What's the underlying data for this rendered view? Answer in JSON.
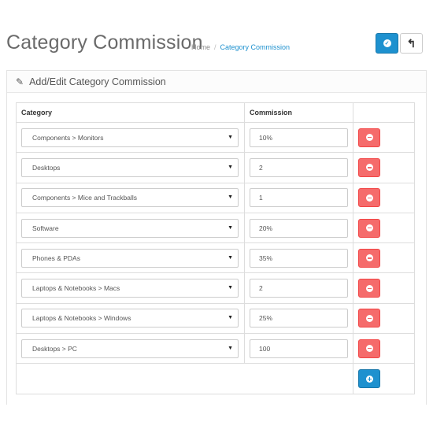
{
  "header": {
    "title": "Category Commission",
    "breadcrumb": [
      {
        "label": "Home"
      },
      {
        "label": "Category Commission"
      }
    ],
    "breadcrumb_separator": "/",
    "save_icon": "check-circle-icon",
    "back_icon": "reply-icon"
  },
  "panel": {
    "title": "Add/Edit Category Commission",
    "icon": "pencil-icon"
  },
  "table": {
    "columns": [
      "Category",
      "Commission",
      ""
    ],
    "rows": [
      {
        "category": "Components  >  Monitors",
        "commission": "10%"
      },
      {
        "category": "Desktops",
        "commission": "2"
      },
      {
        "category": "Components  >  Mice and Trackballs",
        "commission": "1"
      },
      {
        "category": "Software",
        "commission": "20%"
      },
      {
        "category": "Phones & PDAs",
        "commission": "35%"
      },
      {
        "category": "Laptops & Notebooks  >  Macs",
        "commission": "2"
      },
      {
        "category": "Laptops & Notebooks  >  Windows",
        "commission": "25%"
      },
      {
        "category": "Desktops  >  PC",
        "commission": "100"
      }
    ]
  },
  "colors": {
    "primary": "#1e91cf",
    "danger": "#f56b6b",
    "title_gray": "#6a6a6a"
  }
}
